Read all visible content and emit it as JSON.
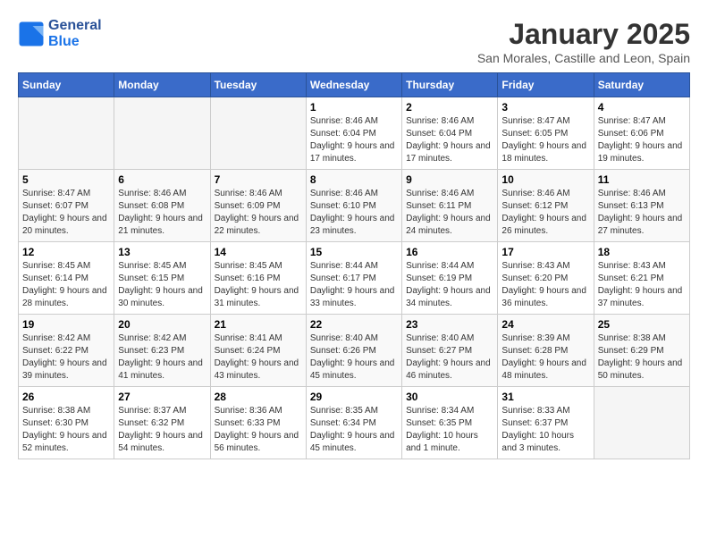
{
  "logo": {
    "line1": "General",
    "line2": "Blue"
  },
  "title": "January 2025",
  "subtitle": "San Morales, Castille and Leon, Spain",
  "days_of_week": [
    "Sunday",
    "Monday",
    "Tuesday",
    "Wednesday",
    "Thursday",
    "Friday",
    "Saturday"
  ],
  "weeks": [
    [
      {
        "day": "",
        "info": ""
      },
      {
        "day": "",
        "info": ""
      },
      {
        "day": "",
        "info": ""
      },
      {
        "day": "1",
        "info": "Sunrise: 8:46 AM\nSunset: 6:04 PM\nDaylight: 9 hours and 17 minutes."
      },
      {
        "day": "2",
        "info": "Sunrise: 8:46 AM\nSunset: 6:04 PM\nDaylight: 9 hours and 17 minutes."
      },
      {
        "day": "3",
        "info": "Sunrise: 8:47 AM\nSunset: 6:05 PM\nDaylight: 9 hours and 18 minutes."
      },
      {
        "day": "4",
        "info": "Sunrise: 8:47 AM\nSunset: 6:06 PM\nDaylight: 9 hours and 19 minutes."
      }
    ],
    [
      {
        "day": "5",
        "info": "Sunrise: 8:47 AM\nSunset: 6:07 PM\nDaylight: 9 hours and 20 minutes."
      },
      {
        "day": "6",
        "info": "Sunrise: 8:46 AM\nSunset: 6:08 PM\nDaylight: 9 hours and 21 minutes."
      },
      {
        "day": "7",
        "info": "Sunrise: 8:46 AM\nSunset: 6:09 PM\nDaylight: 9 hours and 22 minutes."
      },
      {
        "day": "8",
        "info": "Sunrise: 8:46 AM\nSunset: 6:10 PM\nDaylight: 9 hours and 23 minutes."
      },
      {
        "day": "9",
        "info": "Sunrise: 8:46 AM\nSunset: 6:11 PM\nDaylight: 9 hours and 24 minutes."
      },
      {
        "day": "10",
        "info": "Sunrise: 8:46 AM\nSunset: 6:12 PM\nDaylight: 9 hours and 26 minutes."
      },
      {
        "day": "11",
        "info": "Sunrise: 8:46 AM\nSunset: 6:13 PM\nDaylight: 9 hours and 27 minutes."
      }
    ],
    [
      {
        "day": "12",
        "info": "Sunrise: 8:45 AM\nSunset: 6:14 PM\nDaylight: 9 hours and 28 minutes."
      },
      {
        "day": "13",
        "info": "Sunrise: 8:45 AM\nSunset: 6:15 PM\nDaylight: 9 hours and 30 minutes."
      },
      {
        "day": "14",
        "info": "Sunrise: 8:45 AM\nSunset: 6:16 PM\nDaylight: 9 hours and 31 minutes."
      },
      {
        "day": "15",
        "info": "Sunrise: 8:44 AM\nSunset: 6:17 PM\nDaylight: 9 hours and 33 minutes."
      },
      {
        "day": "16",
        "info": "Sunrise: 8:44 AM\nSunset: 6:19 PM\nDaylight: 9 hours and 34 minutes."
      },
      {
        "day": "17",
        "info": "Sunrise: 8:43 AM\nSunset: 6:20 PM\nDaylight: 9 hours and 36 minutes."
      },
      {
        "day": "18",
        "info": "Sunrise: 8:43 AM\nSunset: 6:21 PM\nDaylight: 9 hours and 37 minutes."
      }
    ],
    [
      {
        "day": "19",
        "info": "Sunrise: 8:42 AM\nSunset: 6:22 PM\nDaylight: 9 hours and 39 minutes."
      },
      {
        "day": "20",
        "info": "Sunrise: 8:42 AM\nSunset: 6:23 PM\nDaylight: 9 hours and 41 minutes."
      },
      {
        "day": "21",
        "info": "Sunrise: 8:41 AM\nSunset: 6:24 PM\nDaylight: 9 hours and 43 minutes."
      },
      {
        "day": "22",
        "info": "Sunrise: 8:40 AM\nSunset: 6:26 PM\nDaylight: 9 hours and 45 minutes."
      },
      {
        "day": "23",
        "info": "Sunrise: 8:40 AM\nSunset: 6:27 PM\nDaylight: 9 hours and 46 minutes."
      },
      {
        "day": "24",
        "info": "Sunrise: 8:39 AM\nSunset: 6:28 PM\nDaylight: 9 hours and 48 minutes."
      },
      {
        "day": "25",
        "info": "Sunrise: 8:38 AM\nSunset: 6:29 PM\nDaylight: 9 hours and 50 minutes."
      }
    ],
    [
      {
        "day": "26",
        "info": "Sunrise: 8:38 AM\nSunset: 6:30 PM\nDaylight: 9 hours and 52 minutes."
      },
      {
        "day": "27",
        "info": "Sunrise: 8:37 AM\nSunset: 6:32 PM\nDaylight: 9 hours and 54 minutes."
      },
      {
        "day": "28",
        "info": "Sunrise: 8:36 AM\nSunset: 6:33 PM\nDaylight: 9 hours and 56 minutes."
      },
      {
        "day": "29",
        "info": "Sunrise: 8:35 AM\nSunset: 6:34 PM\nDaylight: 9 hours and 45 minutes."
      },
      {
        "day": "30",
        "info": "Sunrise: 8:34 AM\nSunset: 6:35 PM\nDaylight: 10 hours and 1 minute."
      },
      {
        "day": "31",
        "info": "Sunrise: 8:33 AM\nSunset: 6:37 PM\nDaylight: 10 hours and 3 minutes."
      },
      {
        "day": "",
        "info": ""
      }
    ]
  ]
}
